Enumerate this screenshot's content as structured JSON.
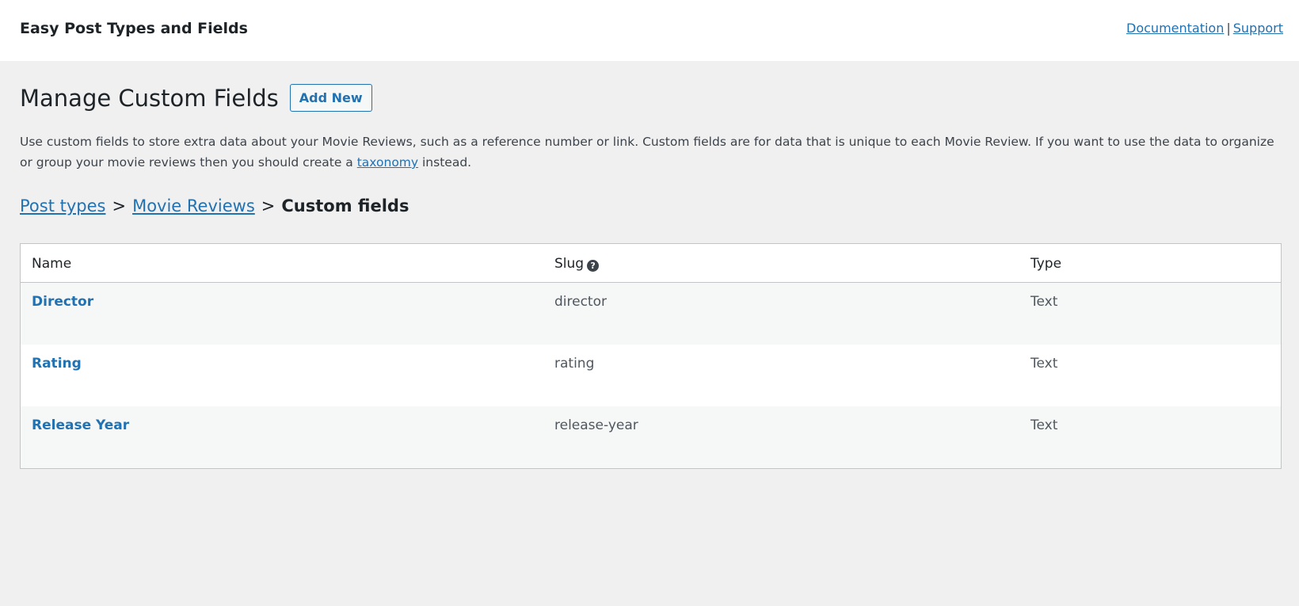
{
  "header": {
    "app_title": "Easy Post Types and Fields",
    "links": {
      "documentation": "Documentation",
      "separator": "|",
      "support": "Support"
    }
  },
  "page": {
    "title": "Manage Custom Fields",
    "add_new_label": "Add New",
    "description_before_link": "Use custom fields to store extra data about your Movie Reviews, such as a reference number or link. Custom fields are for data that is unique to each Movie Review. If you want to use the data to organize or group your movie reviews then you should create a ",
    "description_link": "taxonomy",
    "description_after_link": " instead."
  },
  "breadcrumb": {
    "items": [
      "Post types",
      "Movie Reviews"
    ],
    "separator": ">",
    "current": "Custom fields"
  },
  "table": {
    "columns": {
      "name": "Name",
      "slug": "Slug",
      "type": "Type"
    },
    "slug_help_icon": "help-circle-icon",
    "rows": [
      {
        "name": "Director",
        "slug": "director",
        "type": "Text"
      },
      {
        "name": "Rating",
        "slug": "rating",
        "type": "Text"
      },
      {
        "name": "Release Year",
        "slug": "release-year",
        "type": "Text"
      }
    ]
  },
  "colors": {
    "accent": "#2271b1",
    "background": "#f0f0f1",
    "border": "#c3c4c7",
    "row_alt": "#f6f7f7"
  }
}
